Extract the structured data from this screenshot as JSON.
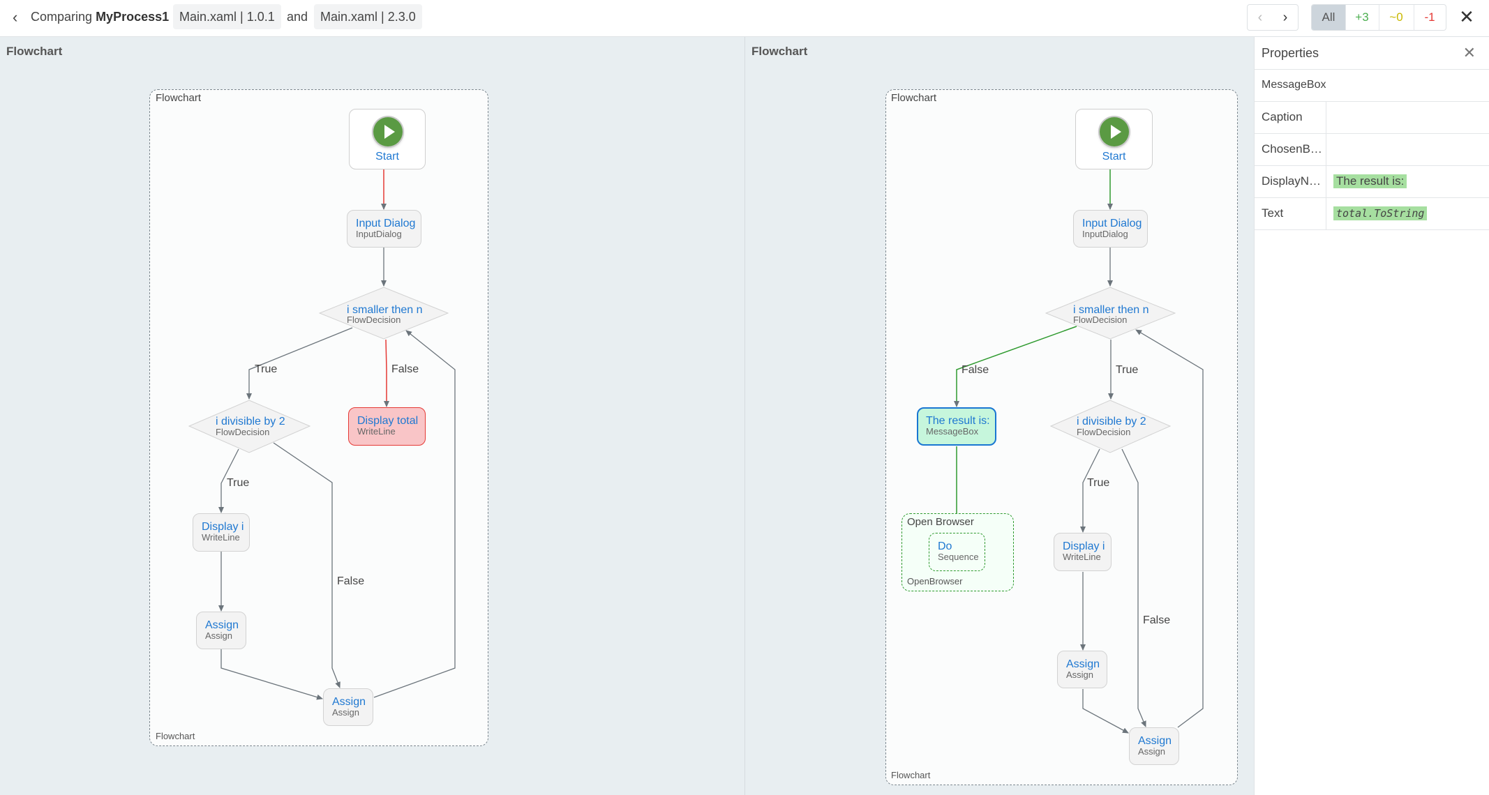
{
  "header": {
    "comparing_label": "Comparing",
    "process_name": "MyProcess1",
    "file_a": "Main.xaml | 1.0.1",
    "and_label": "and",
    "file_b": "Main.xaml | 2.3.0",
    "nav_prev": "‹",
    "nav_next": "›",
    "filters": [
      {
        "label": "All",
        "color": "#555555",
        "active": true
      },
      {
        "label": "+3",
        "color": "#4caf50"
      },
      {
        "label": "~0",
        "color": "#c9b800"
      },
      {
        "label": "-1",
        "color": "#e53935"
      }
    ],
    "close": "✕"
  },
  "left_pane": {
    "title": "Flowchart",
    "container_label": "Flowchart",
    "container_footer": "Flowchart",
    "nodes": {
      "start": "Start",
      "input_dialog": {
        "title": "Input Dialog",
        "type": "InputDialog"
      },
      "decision1": {
        "title": "i smaller then n",
        "type": "FlowDecision"
      },
      "decision2": {
        "title": "i divisible by 2",
        "type": "FlowDecision"
      },
      "display_total": {
        "title": "Display total",
        "type": "WriteLine",
        "status": "removed"
      },
      "display_i": {
        "title": "Display i",
        "type": "WriteLine"
      },
      "assign1": {
        "title": "Assign",
        "type": "Assign"
      },
      "assign2": {
        "title": "Assign",
        "type": "Assign"
      }
    },
    "edge_labels": {
      "d1_true": "True",
      "d1_false": "False",
      "d2_true": "True",
      "d2_false": "False"
    }
  },
  "right_pane": {
    "title": "Flowchart",
    "container_label": "Flowchart",
    "container_footer": "Flowchart",
    "nodes": {
      "start": "Start",
      "input_dialog": {
        "title": "Input Dialog",
        "type": "InputDialog"
      },
      "decision1": {
        "title": "i smaller then n",
        "type": "FlowDecision"
      },
      "message_box": {
        "title": "The result is:",
        "type": "MessageBox",
        "status": "added",
        "selected": true
      },
      "open_browser": {
        "title": "Open Browser",
        "type": "OpenBrowser",
        "status": "added"
      },
      "do_sequence": {
        "title": "Do",
        "type": "Sequence",
        "status": "added"
      },
      "decision2": {
        "title": "i divisible by 2",
        "type": "FlowDecision"
      },
      "display_i": {
        "title": "Display i",
        "type": "WriteLine"
      },
      "assign1": {
        "title": "Assign",
        "type": "Assign"
      },
      "assign2": {
        "title": "Assign",
        "type": "Assign"
      }
    },
    "edge_labels": {
      "d1_false": "False",
      "d1_true": "True",
      "d2_true": "True",
      "d2_false": "False"
    }
  },
  "properties": {
    "title": "Properties",
    "activity_type": "MessageBox",
    "rows": [
      {
        "key": "Caption",
        "value": ""
      },
      {
        "key": "ChosenB…",
        "value": ""
      },
      {
        "key": "DisplayN…",
        "value": "The result is:"
      },
      {
        "key": "Text",
        "value": "total.ToString"
      }
    ]
  },
  "colors": {
    "added": "#2e9a2e",
    "removed": "#e53935",
    "accent": "#1f78d1",
    "highlight": "#a6dfa0"
  }
}
